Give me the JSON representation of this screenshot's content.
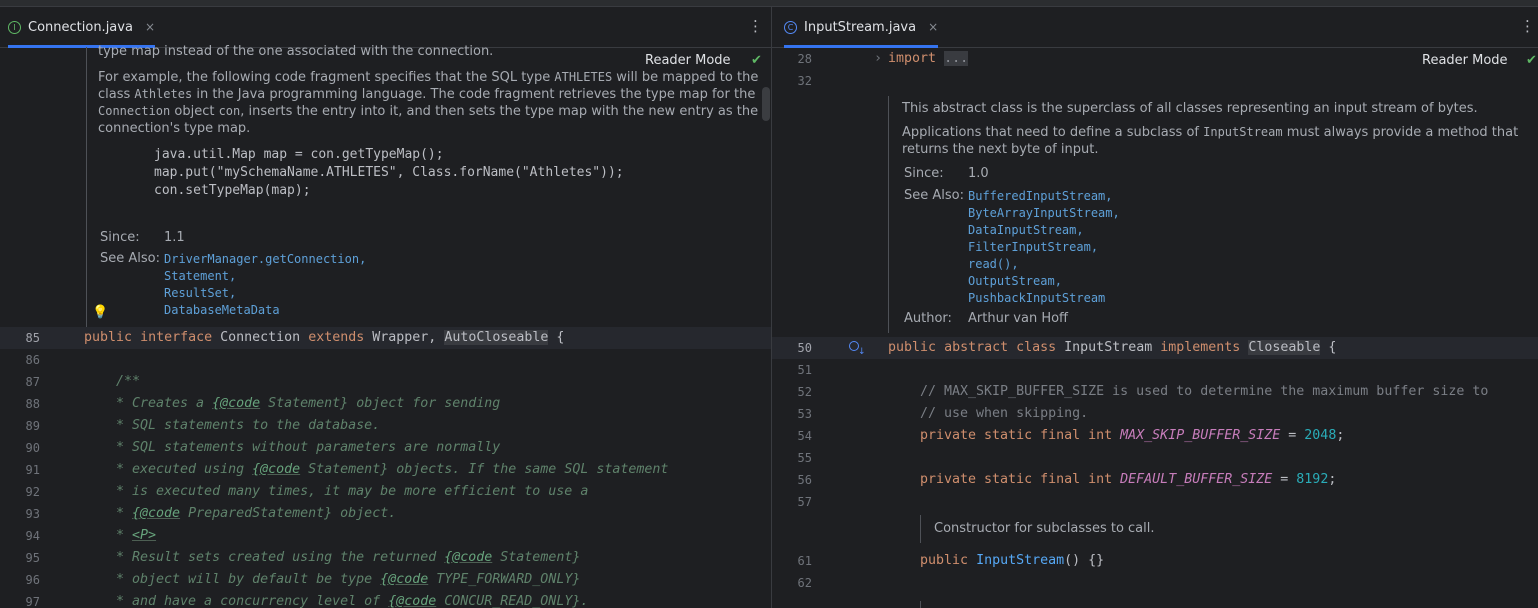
{
  "left": {
    "tab": {
      "title": "Connection.java",
      "icon": "interface-icon",
      "close": "×"
    },
    "more": "⋮",
    "reader_mode": "Reader Mode",
    "doc": {
      "cut_line": "type map instead of the one associated with the connection.",
      "para1": [
        "For example, the following code fragment specifies that the SQL type ",
        "ATHLETES",
        " will be mapped to the",
        "class ",
        "Athletes",
        " in the Java programming language. The code fragment retrieves the type map for the",
        "Connection",
        " object ",
        "con",
        ", inserts the entry into it, and then sets the type map with the new entry as the",
        "connection's type map."
      ],
      "code": [
        "java.util.Map map = con.getTypeMap();",
        "map.put(\"mySchemaName.ATHLETES\", Class.forName(\"Athletes\"));",
        "con.setTypeMap(map);"
      ],
      "since_label": "Since:",
      "since_value": "1.1",
      "see_also_label": "See Also:",
      "see_also": [
        "DriverManager.getConnection,",
        "Statement,",
        "ResultSet,",
        "DatabaseMetaData"
      ]
    },
    "lines": [
      "85",
      "86",
      "87",
      "88",
      "89",
      "90",
      "91",
      "92",
      "93",
      "94",
      "95",
      "96",
      "97"
    ],
    "code": {
      "l85": [
        "public",
        " ",
        "interface",
        " Connection ",
        "extends",
        " Wrapper, ",
        "AutoCloseable",
        " {"
      ],
      "l87": "/**",
      "l88": [
        "* Creates a ",
        "{@code",
        " Statement} object for sending"
      ],
      "l89": "* SQL statements to the database.",
      "l90": "* SQL statements without parameters are normally",
      "l91": [
        "* executed using ",
        "{@code",
        " Statement} objects. If the same SQL statement"
      ],
      "l92": "* is executed many times, it may be more efficient to use a",
      "l93": [
        "* ",
        "{@code",
        " PreparedStatement} object."
      ],
      "l94": [
        "* ",
        "<P>"
      ],
      "l95": [
        "* Result sets created using the returned ",
        "{@code",
        " Statement}"
      ],
      "l96": [
        "* object will by default be type ",
        "{@code",
        " TYPE_FORWARD_ONLY}"
      ],
      "l97": [
        "* and have a concurrency level of ",
        "{@code",
        " CONCUR_READ_ONLY}."
      ]
    }
  },
  "right": {
    "tab": {
      "title": "InputStream.java",
      "icon": "class-icon",
      "close": "×"
    },
    "more": "⋮",
    "reader_mode": "Reader Mode",
    "lines_top": [
      "28",
      "32"
    ],
    "import_kw": "import",
    "import_fold": "...",
    "doc": {
      "p1": "This abstract class is the superclass of all classes representing an input stream of bytes.",
      "p2": [
        "Applications that need to define a subclass of ",
        "InputStream",
        " must always provide a method that",
        "returns the next byte of input."
      ],
      "since_label": "Since:",
      "since_value": "1.0",
      "see_also_label": "See Also:",
      "see_also": [
        "BufferedInputStream,",
        "ByteArrayInputStream,",
        "DataInputStream,",
        "FilterInputStream,",
        "read(),",
        "OutputStream,",
        "PushbackInputStream"
      ],
      "author_label": "Author:",
      "author_value": "Arthur van Hoff"
    },
    "lines": [
      "50",
      "51",
      "52",
      "53",
      "54",
      "55",
      "56",
      "57",
      "61",
      "62"
    ],
    "code": {
      "l50": [
        "public",
        " ",
        "abstract",
        " ",
        "class",
        " InputStream ",
        "implements",
        " ",
        "Closeable",
        " {"
      ],
      "l52": "// MAX_SKIP_BUFFER_SIZE is used to determine the maximum buffer size to",
      "l53": "// use when skipping.",
      "l54": [
        "private static final int",
        " ",
        "MAX_SKIP_BUFFER_SIZE",
        " = ",
        "2048",
        ";"
      ],
      "l56": [
        "private static final int",
        " ",
        "DEFAULT_BUFFER_SIZE",
        " = ",
        "8192",
        ";"
      ],
      "ctor_doc": "Constructor for subclasses to call.",
      "l61": [
        "public",
        " ",
        "InputStream",
        "() {}"
      ]
    }
  },
  "colors": {
    "keyword": "#cf8e6d",
    "comment": "#7a7e85",
    "javadoc": "#5f826b",
    "constant": "#c77dbb",
    "number": "#2aacb8",
    "link": "#5ea0d8",
    "accent": "#3574f0"
  }
}
